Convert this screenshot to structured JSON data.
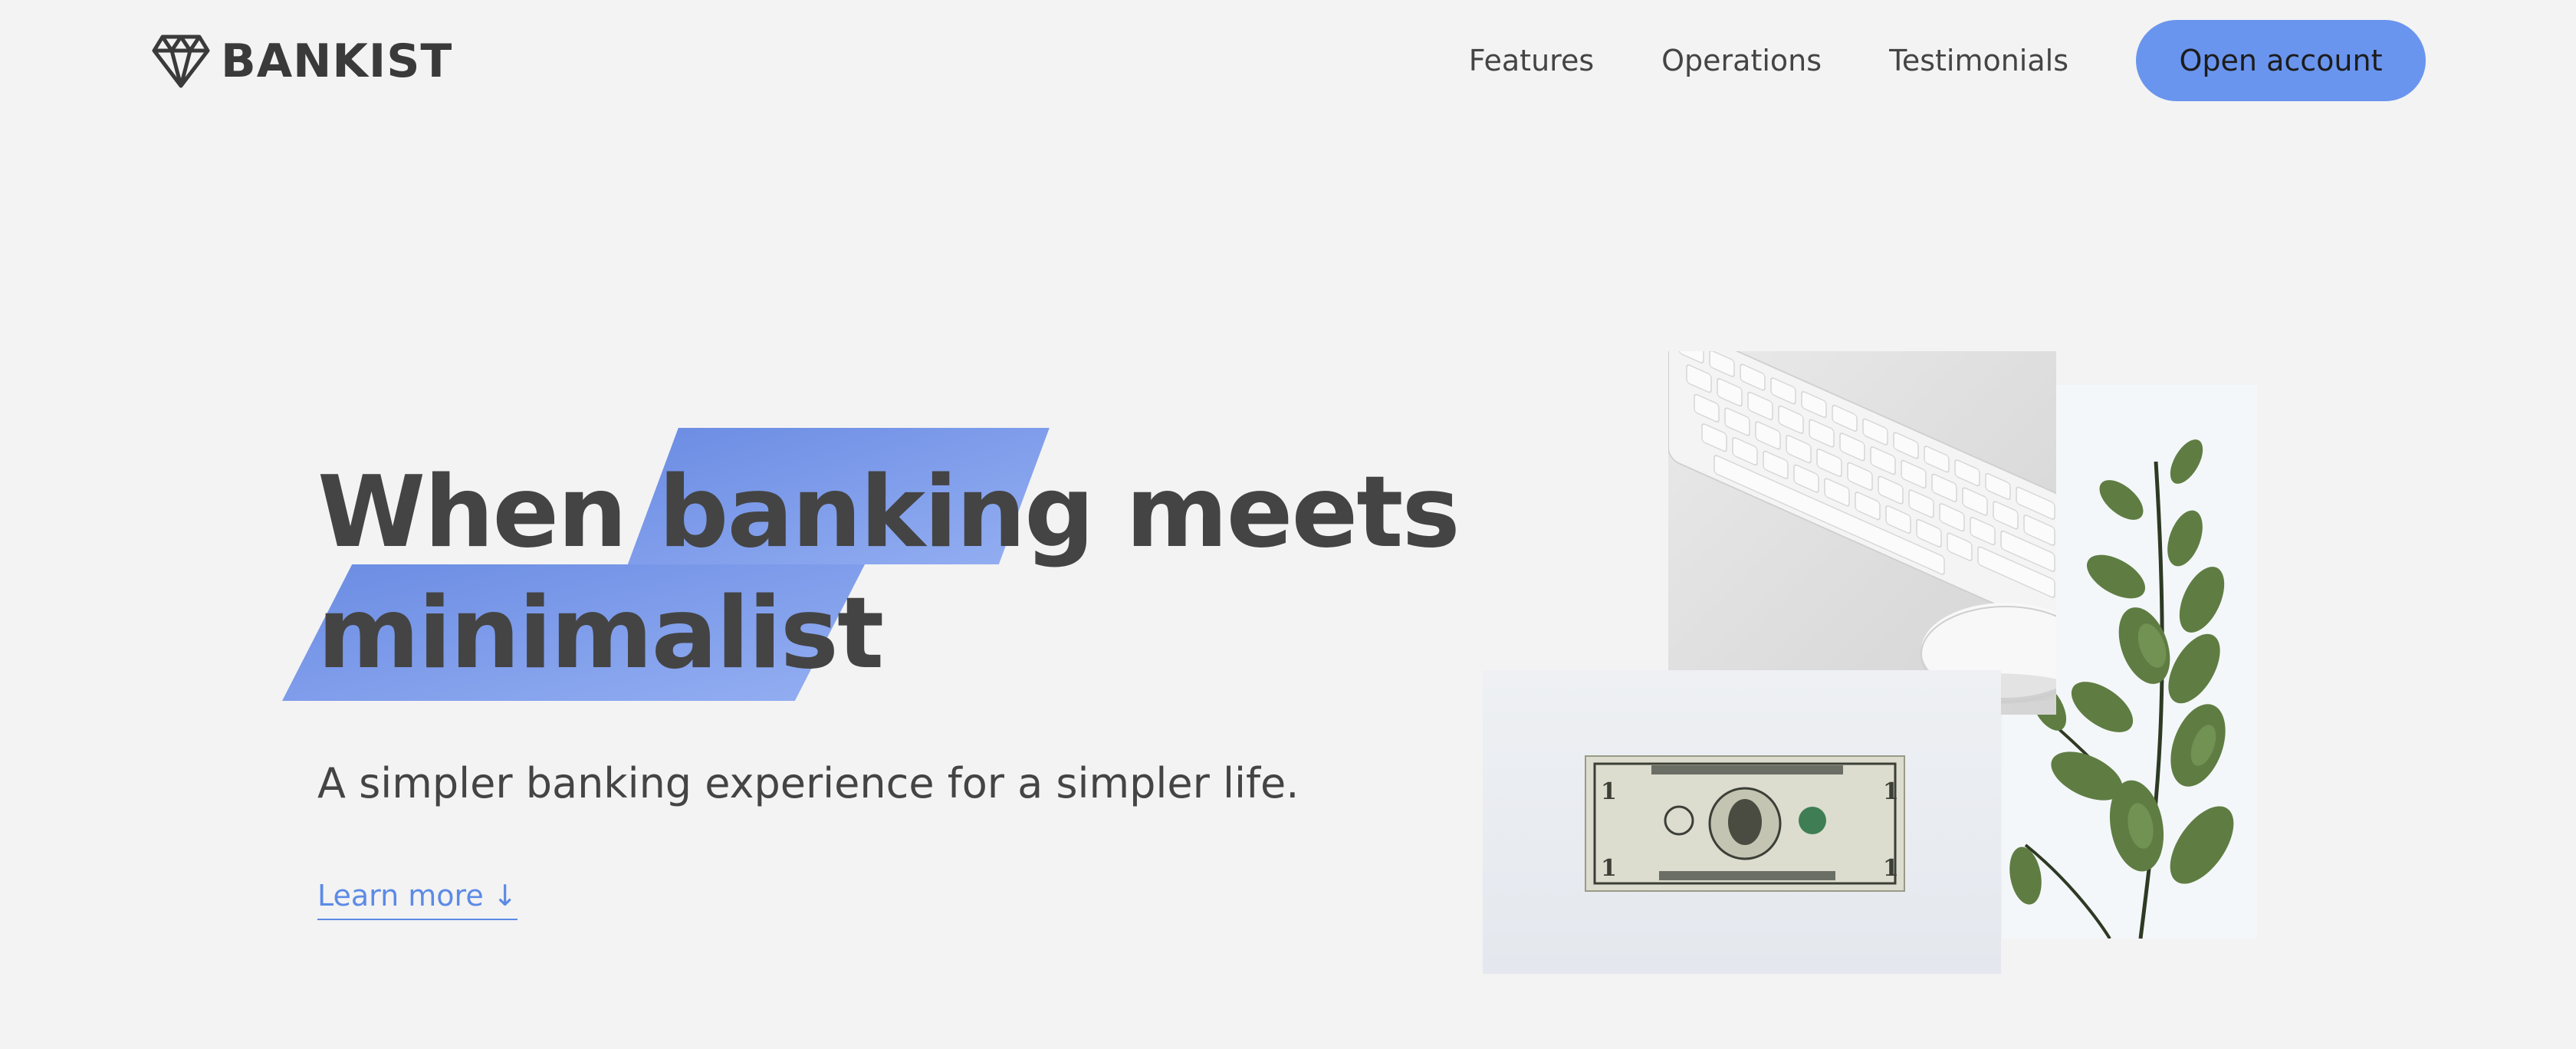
{
  "brand": {
    "name": "BANKIST"
  },
  "nav": {
    "links": [
      "Features",
      "Operations",
      "Testimonials"
    ],
    "cta_label": "Open account"
  },
  "hero": {
    "title_line1_a": "When",
    "title_line1_highlight": "banking",
    "title_line1_b": "meets",
    "title_line2_highlight": "minimalist",
    "subtitle": "A simpler banking experience for a simpler life.",
    "learn_more": "Learn more ↓"
  },
  "colors": {
    "background": "#f3f3f3",
    "accent": "#6a95ee",
    "link": "#5c8be6",
    "text": "#444444"
  },
  "icons": {
    "logo": "diamond-icon"
  }
}
